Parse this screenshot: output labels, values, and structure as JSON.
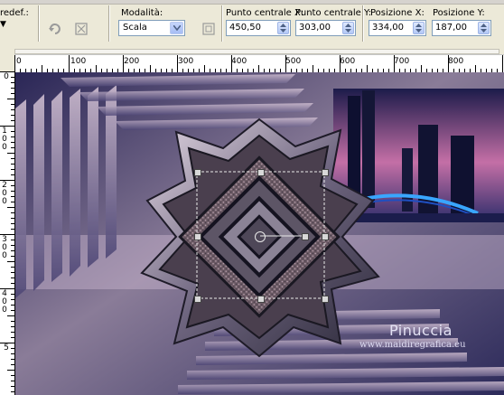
{
  "toolbar": {
    "preset_label": "redef.:",
    "mode_label": "Modalità:",
    "mode_value": "Scala",
    "center_x_label": "Punto centrale X:",
    "center_x_value": "450,50",
    "center_y_label": "Punto centrale Y:",
    "center_y_value": "303,00",
    "pos_x_label": "Posizione X:",
    "pos_x_value": "334,00",
    "pos_y_label": "Posizione Y:",
    "pos_y_value": "187,00"
  },
  "ruler_top": [
    "0",
    "100",
    "200",
    "300",
    "400",
    "500",
    "600",
    "700",
    "800"
  ],
  "ruler_left": [
    "0",
    "1 0 0",
    "2 0 0",
    "3 0 0",
    "4 0 0",
    "5"
  ],
  "canvas": {
    "signature_name": "Pinuccia",
    "signature_url": "www.maidiregrafica.eu"
  },
  "colors": {
    "background": "#2e2b5c",
    "accent": "#c9a9c8",
    "selection": "#e8e8e8"
  }
}
